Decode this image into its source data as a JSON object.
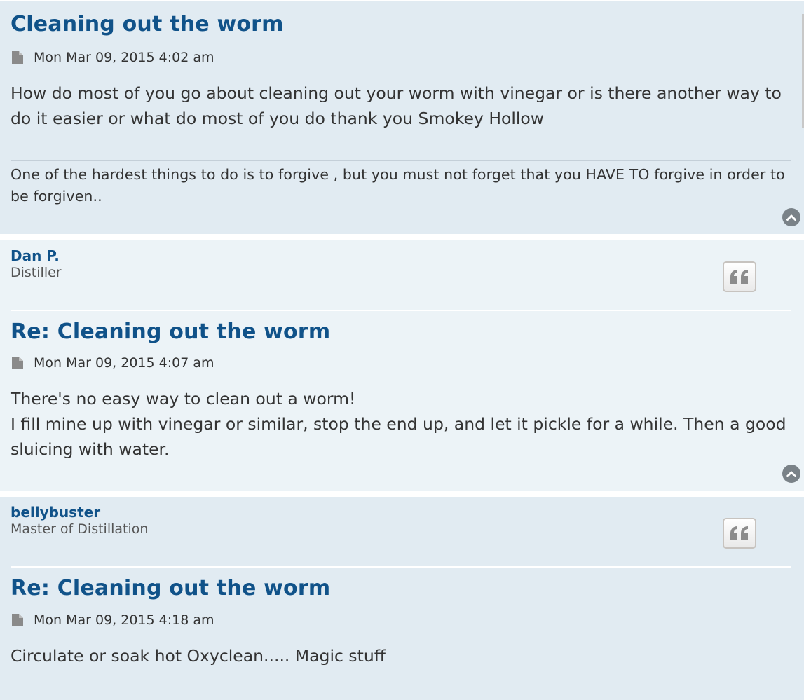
{
  "posts": [
    {
      "title": "Cleaning out the worm",
      "timestamp": "Mon Mar 09, 2015 4:02 am",
      "content": [
        "How do most of you go about cleaning out your worm with vinegar or is there another way to do it easier or what do most of you do thank you Smokey Hollow"
      ],
      "signature": "One of the hardest things to do is to forgive , but you must not forget that you HAVE TO forgive in order to be forgiven.."
    },
    {
      "author": "Dan P.",
      "rank": "Distiller",
      "title": "Re: Cleaning out the worm",
      "timestamp": "Mon Mar 09, 2015 4:07 am",
      "content": [
        "There's no easy way to clean out a worm!",
        "I fill mine up with vinegar or similar, stop the end up, and let it pickle for a while. Then a good sluicing with water."
      ]
    },
    {
      "author": "bellybuster",
      "rank": "Master of Distillation",
      "title": "Re: Cleaning out the worm",
      "timestamp": "Mon Mar 09, 2015 4:18 am",
      "content": [
        "Circulate or soak hot Oxyclean..... Magic stuff"
      ]
    }
  ],
  "icons": {
    "post": "file-icon",
    "quote": "quote-icon",
    "top": "chevron-up-circle-icon"
  },
  "colors": {
    "title": "#105289",
    "post_bg_1": "#e1ebf2",
    "post_bg_2": "#ecf3f7"
  }
}
